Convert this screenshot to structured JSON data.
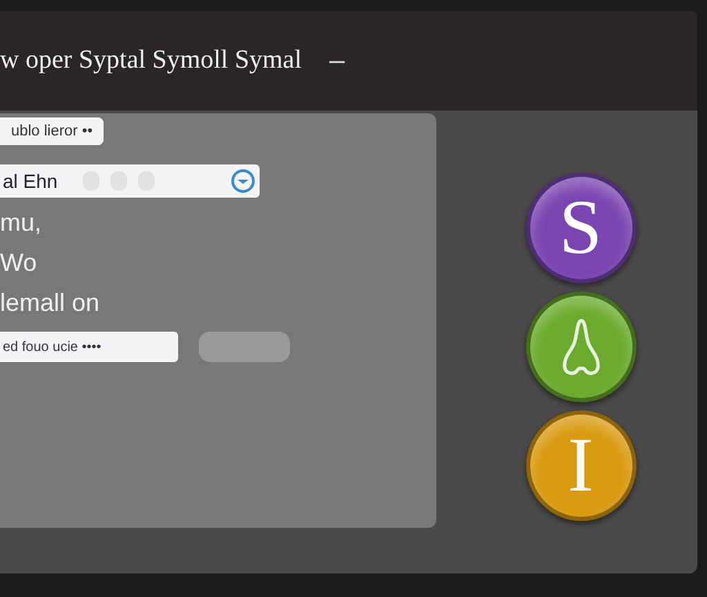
{
  "window": {
    "title": "w oper Syptal Symoll Symal",
    "minimize": "–"
  },
  "panel": {
    "chip": "ublo lieror ••",
    "field": {
      "value": "al Ehn"
    },
    "lines": [
      "mu,",
      "Wo",
      "lemall on"
    ],
    "input": {
      "value": "ed fouo ucie ••••"
    }
  },
  "badges": [
    {
      "kind": "letter",
      "label": "S",
      "color": "#7a45b0"
    },
    {
      "kind": "pear",
      "color": "#6aaa2c"
    },
    {
      "kind": "letter",
      "label": "I",
      "color": "#d99a10"
    }
  ]
}
